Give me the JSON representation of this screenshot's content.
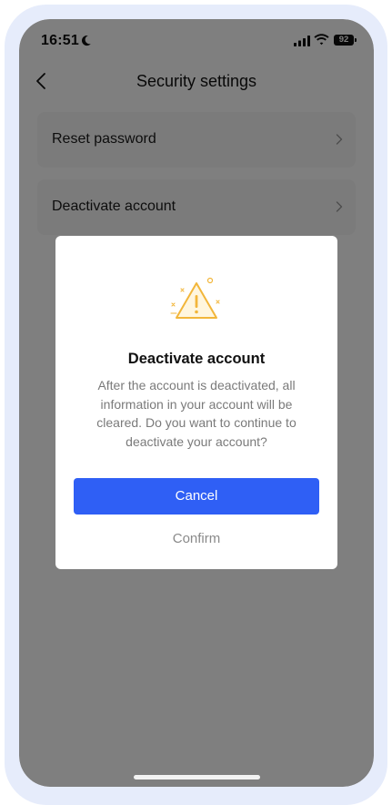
{
  "status_bar": {
    "time": "16:51",
    "battery": "92"
  },
  "nav": {
    "title": "Security settings"
  },
  "settings": {
    "items": [
      {
        "label": "Reset password"
      },
      {
        "label": "Deactivate account"
      }
    ]
  },
  "dialog": {
    "icon": "warning-icon",
    "title": "Deactivate account",
    "message": "After the account is deactivated, all information in your account will be cleared. Do you want to continue to deactivate your account?",
    "cancel_label": "Cancel",
    "confirm_label": "Confirm"
  },
  "colors": {
    "primary": "#2f5ff5",
    "warning": "#f2b63a",
    "overlay": "rgba(0,0,0,0.5)"
  }
}
